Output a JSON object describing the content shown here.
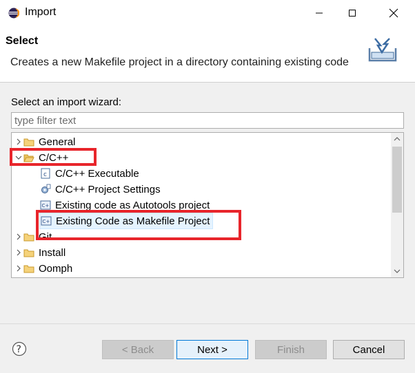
{
  "window": {
    "title": "Import"
  },
  "header": {
    "title": "Select",
    "description": "Creates a new Makefile project in a directory containing existing code"
  },
  "wizard": {
    "label": "Select an import wizard:",
    "filter_placeholder": "type filter text",
    "filter_value": ""
  },
  "tree": {
    "items": [
      {
        "label": "General",
        "expanded": false,
        "type": "folder"
      },
      {
        "label": "C/C++",
        "expanded": true,
        "type": "folder"
      },
      {
        "label": "C/C++ Executable",
        "type": "cpp-executable"
      },
      {
        "label": "C/C++ Project Settings",
        "type": "project-settings"
      },
      {
        "label": "Existing code as Autotools project",
        "type": "autotools"
      },
      {
        "label": "Existing Code as Makefile Project",
        "type": "makefile",
        "selected": true
      },
      {
        "label": "Git",
        "expanded": false,
        "type": "folder"
      },
      {
        "label": "Install",
        "expanded": false,
        "type": "folder"
      },
      {
        "label": "Oomph",
        "expanded": false,
        "type": "folder"
      }
    ]
  },
  "buttons": {
    "back": "< Back",
    "next": "Next >",
    "finish": "Finish",
    "cancel": "Cancel"
  },
  "colors": {
    "highlight_border": "#e8252b",
    "selection_bg": "#e5f3ff",
    "default_button_border": "#0078d7"
  }
}
